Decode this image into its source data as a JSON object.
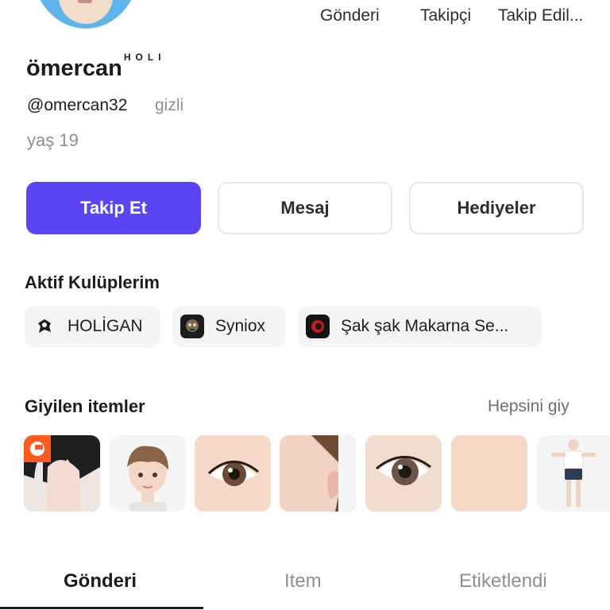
{
  "profile": {
    "display_name": "ömercan",
    "name_badge": "HOLI",
    "handle": "@omercan32",
    "privacy": "gizli",
    "age": "yaş 19"
  },
  "stats": [
    "Gönderi",
    "Takipçi",
    "Takip Edil..."
  ],
  "actions": {
    "follow": "Takip Et",
    "message": "Mesaj",
    "gifts": "Hediyeler"
  },
  "clubs": {
    "title": "Aktif Kulüplerim",
    "items": [
      "HOLİGAN",
      "Syniox",
      "Şak şak Makarna Se..."
    ]
  },
  "worn_items": {
    "title": "Giyilen itemler",
    "wear_all": "Hepsini giy",
    "items": [
      "hair",
      "head",
      "eyes",
      "ear",
      "eyes-alt",
      "skin",
      "body"
    ]
  },
  "tabs": [
    {
      "label": "Gönderi",
      "active": true
    },
    {
      "label": "Item",
      "active": false
    },
    {
      "label": "Etiketlendi",
      "active": false
    }
  ],
  "colors": {
    "primary": "#5b44f2",
    "muted": "#8e8e93",
    "chip_bg": "#f4f4f6"
  }
}
